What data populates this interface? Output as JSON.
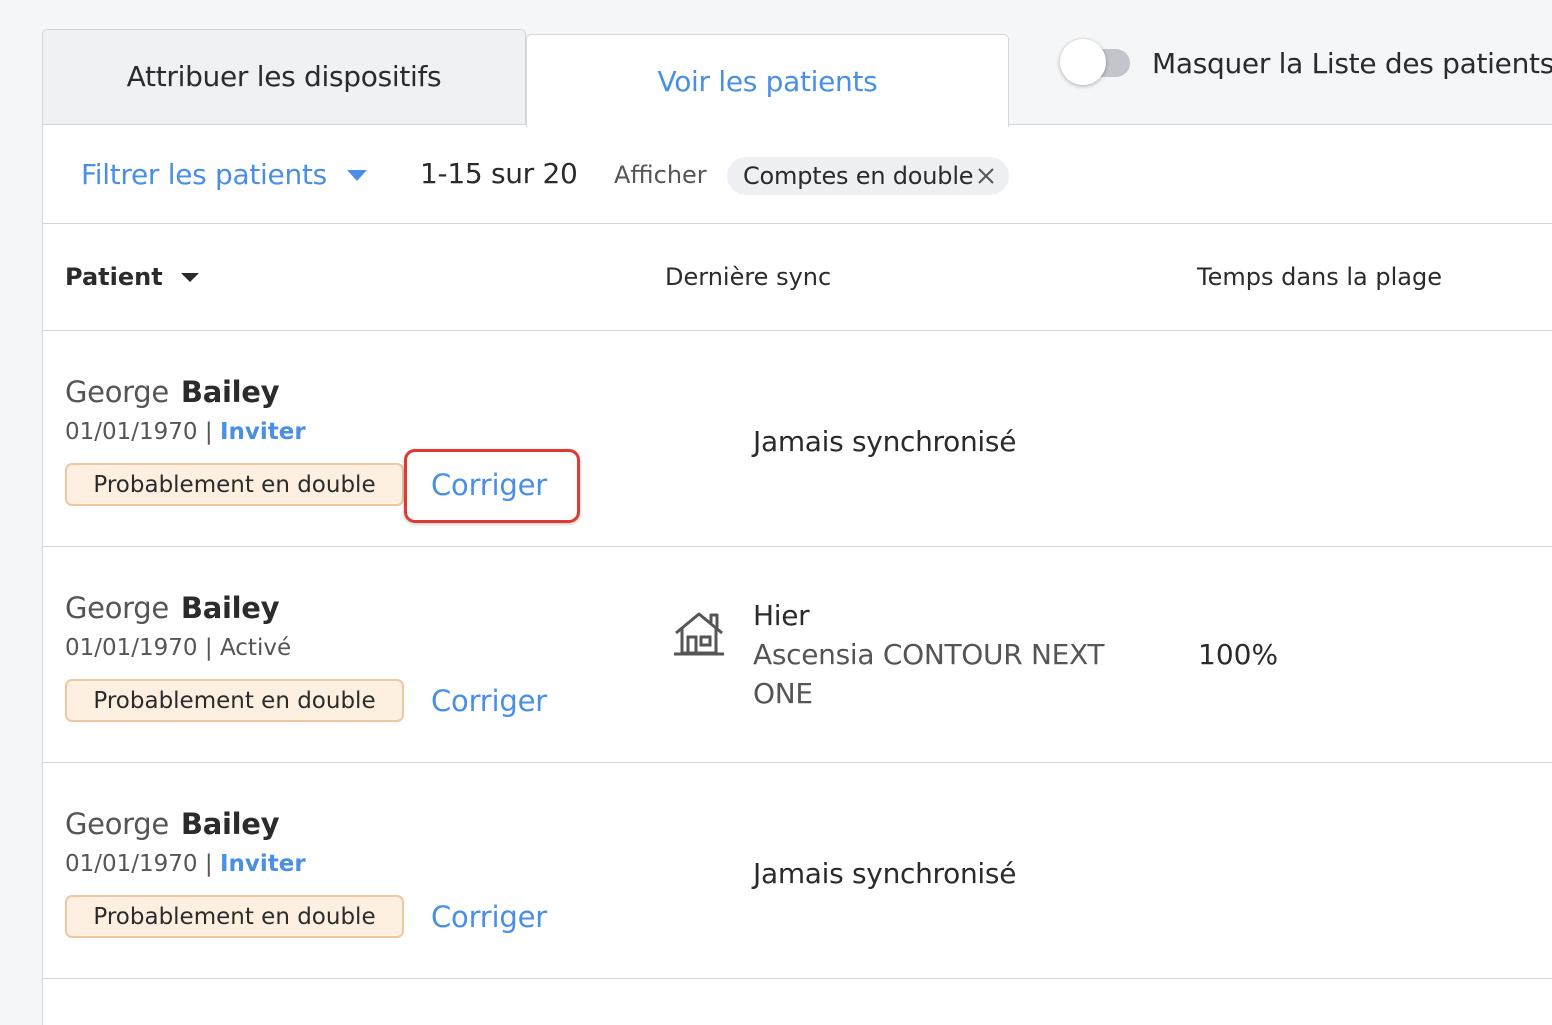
{
  "tabs": {
    "assign": "Attribuer les dispositifs",
    "view": "Voir les patients"
  },
  "toggle": {
    "label": "Masquer la Liste des patients",
    "on": false
  },
  "filter": {
    "label": "Filtrer les patients",
    "count": "1-15 sur 20",
    "show_label": "Afficher",
    "chip": "Comptes en double"
  },
  "table": {
    "columns": {
      "patient": "Patient",
      "last_sync": "Dernière sync",
      "time_in_range": "Temps dans la plage"
    },
    "rows": [
      {
        "first_name": "George",
        "last_name": "Bailey",
        "dob": "01/01/1970",
        "separator": "|",
        "status": "Inviter",
        "badge": "Probablement en double",
        "action": "Corriger",
        "sync": "Jamais synchronisé",
        "device": "",
        "time_in_range": ""
      },
      {
        "first_name": "George",
        "last_name": "Bailey",
        "dob": "01/01/1970",
        "separator": "|",
        "status": "Activé",
        "badge": "Probablement en double",
        "action": "Corriger",
        "sync": "Hier",
        "device": "Ascensia CONTOUR NEXT ONE",
        "time_in_range": "100%"
      },
      {
        "first_name": "George",
        "last_name": "Bailey",
        "dob": "01/01/1970",
        "separator": "|",
        "status": "Inviter",
        "badge": "Probablement en double",
        "action": "Corriger",
        "sync": "Jamais synchronisé",
        "device": "",
        "time_in_range": ""
      }
    ]
  },
  "colors": {
    "accent": "#4a8fe6",
    "badge_bg": "#fdf0e1",
    "badge_border": "#efc7a0",
    "highlight": "#dd3b31"
  },
  "icons": {
    "filter_caret": "chevron-down-icon",
    "sort_caret": "chevron-down-icon",
    "chip_close": "close-icon",
    "sync_home": "home-icon"
  }
}
